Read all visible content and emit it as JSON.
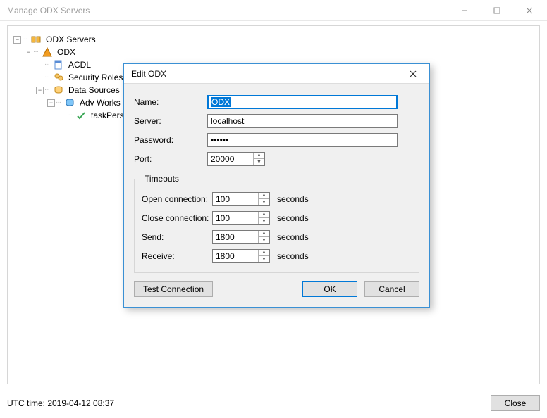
{
  "window": {
    "title": "Manage ODX Servers"
  },
  "tree": {
    "root": "ODX Servers",
    "odx": "ODX",
    "acdl": "ACDL",
    "security_roles": "Security Roles",
    "data_sources": "Data Sources",
    "adv_works": "Adv Works",
    "task_person": "taskPerson"
  },
  "dialog": {
    "title": "Edit ODX",
    "labels": {
      "name": "Name:",
      "server": "Server:",
      "password": "Password:",
      "port": "Port:"
    },
    "values": {
      "name": "ODX",
      "server": "localhost",
      "password": "••••••",
      "port": "20000"
    },
    "timeouts": {
      "legend": "Timeouts",
      "open_label": "Open connection:",
      "close_label": "Close connection:",
      "send_label": "Send:",
      "receive_label": "Receive:",
      "open": "100",
      "close": "100",
      "send": "1800",
      "receive": "1800",
      "unit": "seconds"
    },
    "buttons": {
      "test": "Test Connection",
      "ok": "OK",
      "cancel": "Cancel"
    }
  },
  "footer": {
    "utc_label": "UTC time: 2019-04-12 08:37",
    "close": "Close"
  }
}
